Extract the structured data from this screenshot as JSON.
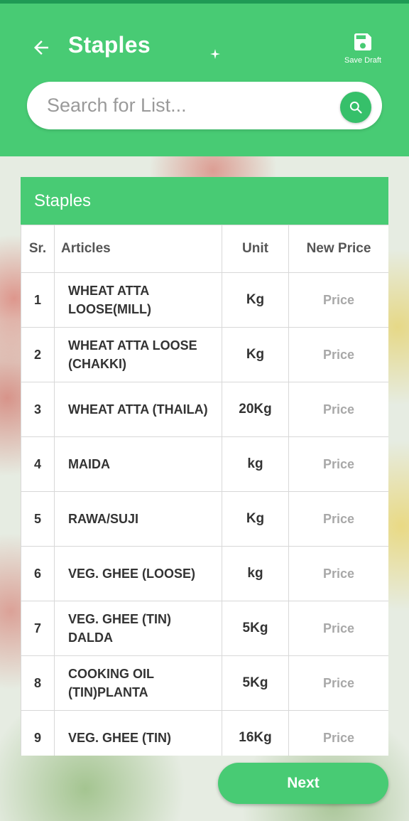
{
  "header": {
    "title": "Staples",
    "back_icon": "arrow-left-icon",
    "save_draft_label": "Save Draft",
    "save_icon": "floppy-disk-icon",
    "accent": "#48cb74"
  },
  "search": {
    "placeholder": "Search for List...",
    "value": "",
    "icon": "search-icon"
  },
  "table": {
    "section_title": "Staples",
    "columns": [
      "Sr.",
      "Articles",
      "Unit",
      "New Price"
    ],
    "rows": [
      {
        "sr": "1",
        "article": "WHEAT ATTA LOOSE(MILL)",
        "unit": "Kg",
        "price_placeholder": "Price"
      },
      {
        "sr": "2",
        "article": "WHEAT ATTA LOOSE (CHAKKI)",
        "unit": "Kg",
        "price_placeholder": "Price"
      },
      {
        "sr": "3",
        "article": "WHEAT ATTA (THAILA)",
        "unit": "20Kg",
        "price_placeholder": "Price"
      },
      {
        "sr": "4",
        "article": "MAIDA",
        "unit": "kg",
        "price_placeholder": "Price"
      },
      {
        "sr": "5",
        "article": "RAWA/SUJI",
        "unit": "Kg",
        "price_placeholder": "Price"
      },
      {
        "sr": "6",
        "article": "VEG. GHEE (LOOSE)",
        "unit": "kg",
        "price_placeholder": "Price"
      },
      {
        "sr": "7",
        "article": "VEG. GHEE (TIN) DALDA",
        "unit": "5Kg",
        "price_placeholder": "Price"
      },
      {
        "sr": "8",
        "article": "COOKING OIL (TIN)PLANTA",
        "unit": "5Kg",
        "price_placeholder": "Price"
      },
      {
        "sr": "9",
        "article": "VEG. GHEE (TIN)",
        "unit": "16Kg",
        "price_placeholder": "Price"
      }
    ]
  },
  "footer": {
    "next_label": "Next"
  }
}
